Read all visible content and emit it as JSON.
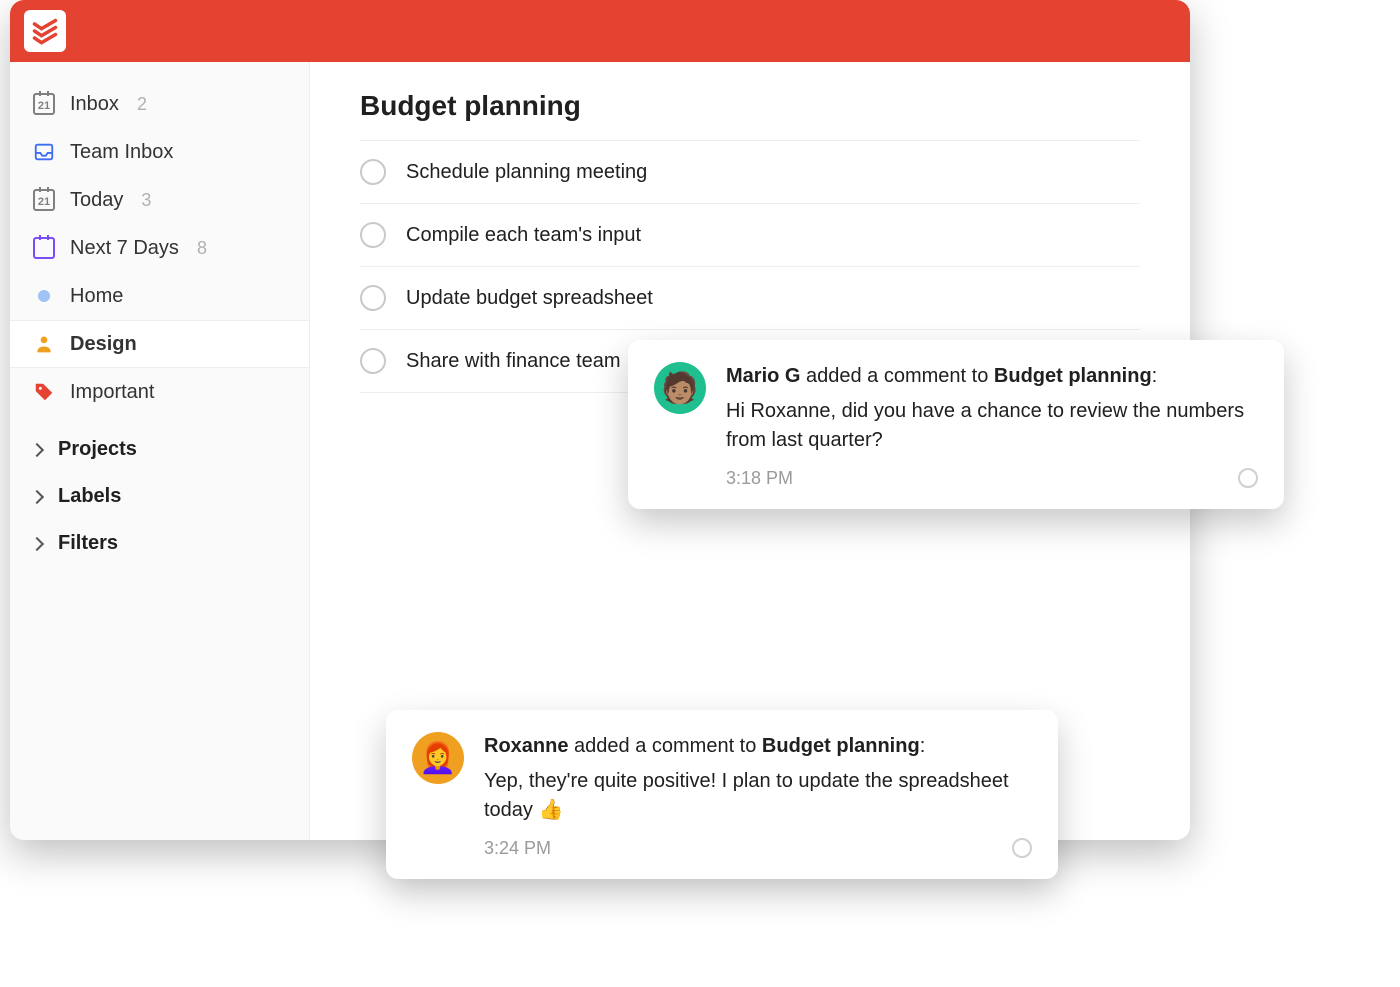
{
  "sidebar": {
    "items": [
      {
        "label": "Inbox",
        "count": "2",
        "icon": "inbox-cal"
      },
      {
        "label": "Team Inbox",
        "count": "",
        "icon": "team-inbox"
      },
      {
        "label": "Today",
        "count": "3",
        "icon": "today-cal"
      },
      {
        "label": "Next 7 Days",
        "count": "8",
        "icon": "next7"
      },
      {
        "label": "Home",
        "count": "",
        "icon": "dot"
      },
      {
        "label": "Design",
        "count": "",
        "icon": "person",
        "selected": true
      },
      {
        "label": "Important",
        "count": "",
        "icon": "tag"
      }
    ],
    "sections": [
      {
        "label": "Projects"
      },
      {
        "label": "Labels"
      },
      {
        "label": "Filters"
      }
    ]
  },
  "project": {
    "title": "Budget planning",
    "tasks": [
      {
        "title": "Schedule planning meeting"
      },
      {
        "title": "Compile each team's input"
      },
      {
        "title": "Update budget spreadsheet"
      },
      {
        "title": "Share with finance team"
      }
    ]
  },
  "notifications": [
    {
      "author": "Mario G",
      "action_mid": " added a comment to ",
      "project": "Budget planning",
      "action_suffix": ":",
      "message": "Hi Roxanne, did you have a chance to review the numbers from last quarter?",
      "time": "3:18 PM",
      "avatar_emoji": "🧑🏽"
    },
    {
      "author": "Roxanne",
      "action_mid": " added a comment to ",
      "project": "Budget planning",
      "action_suffix": ":",
      "message": "Yep, they're quite positive! I plan to update the spreadsheet today 👍",
      "time": "3:24 PM",
      "avatar_emoji": "👩‍🦰"
    }
  ],
  "calendar_day": "21"
}
